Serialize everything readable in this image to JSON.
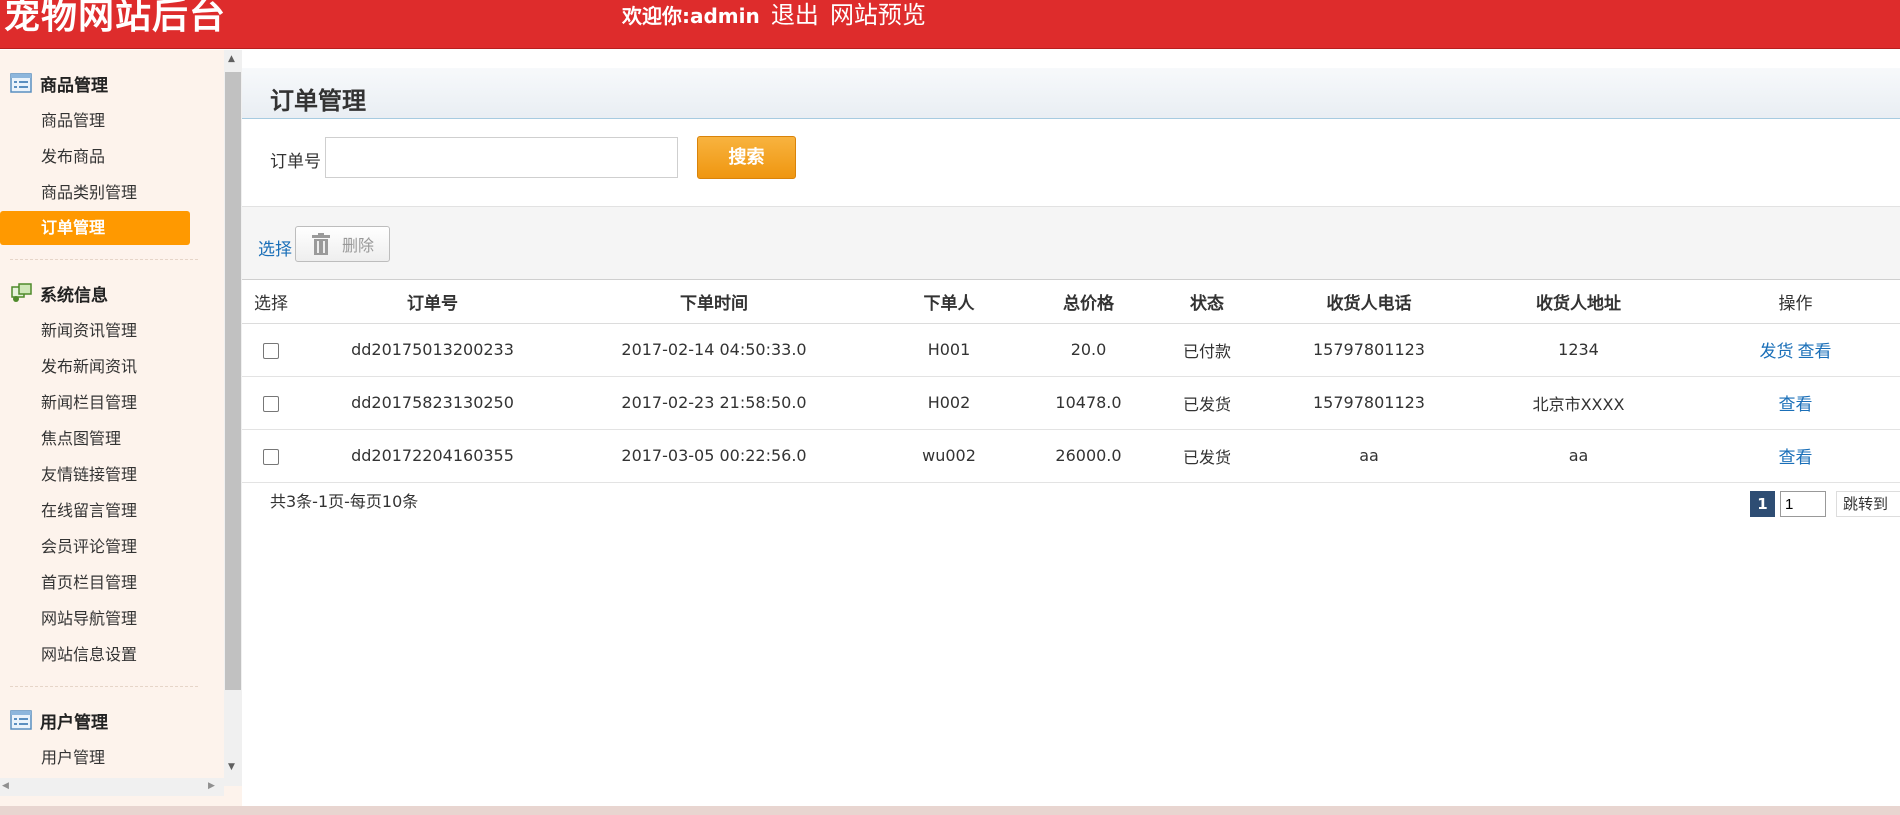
{
  "header": {
    "site_title": "宠物网站后台",
    "welcome": "欢迎你:admin",
    "logout": "退出",
    "preview": "网站预览"
  },
  "sidebar": {
    "groups": [
      {
        "title": "商品管理",
        "icon": "list-panel-icon",
        "items": [
          "商品管理",
          "发布商品",
          "商品类别管理",
          "订单管理"
        ]
      },
      {
        "title": "系统信息",
        "icon": "system-info-icon",
        "items": [
          "新闻资讯管理",
          "发布新闻资讯",
          "新闻栏目管理",
          "焦点图管理",
          "友情链接管理",
          "在线留言管理",
          "会员评论管理",
          "首页栏目管理",
          "网站导航管理",
          "网站信息设置"
        ]
      },
      {
        "title": "用户管理",
        "icon": "list-panel-icon",
        "items": [
          "用户管理"
        ]
      }
    ],
    "active_item": "订单管理"
  },
  "main": {
    "title": "订单管理",
    "search": {
      "label": "订单号",
      "value": "",
      "placeholder": "",
      "button": "搜索"
    },
    "toolbar": {
      "select": "选择",
      "delete": "删除"
    },
    "table": {
      "headers": [
        "选择",
        "订单号",
        "下单时间",
        "下单人",
        "总价格",
        "状态",
        "收货人电话",
        "收货人地址",
        "操作"
      ],
      "rows": [
        {
          "order_no": "dd20175013200233",
          "time": "2017-02-14 04:50:33.0",
          "user": "H001",
          "total": "20.0",
          "status": "已付款",
          "phone": "15797801123",
          "address": "1234",
          "actions": [
            "发货",
            "查看"
          ]
        },
        {
          "order_no": "dd20175823130250",
          "time": "2017-02-23 21:58:50.0",
          "user": "H002",
          "total": "10478.0",
          "status": "已发货",
          "phone": "15797801123",
          "address": "北京市XXXX",
          "actions": [
            "查看"
          ]
        },
        {
          "order_no": "dd20172204160355",
          "time": "2017-03-05 00:22:56.0",
          "user": "wu002",
          "total": "26000.0",
          "status": "已发货",
          "phone": "aa",
          "address": "aa",
          "actions": [
            "查看"
          ]
        }
      ]
    },
    "pager": {
      "info": "共3条-1页-每页10条",
      "current": "1",
      "input_value": "1",
      "goto": "跳转到"
    }
  },
  "colors": {
    "header_bg": "#de2c2c",
    "active_item_bg": "#ff9900",
    "search_button": "#f4a326",
    "link": "#1a6fb8",
    "pager_current": "#2e4d73"
  }
}
